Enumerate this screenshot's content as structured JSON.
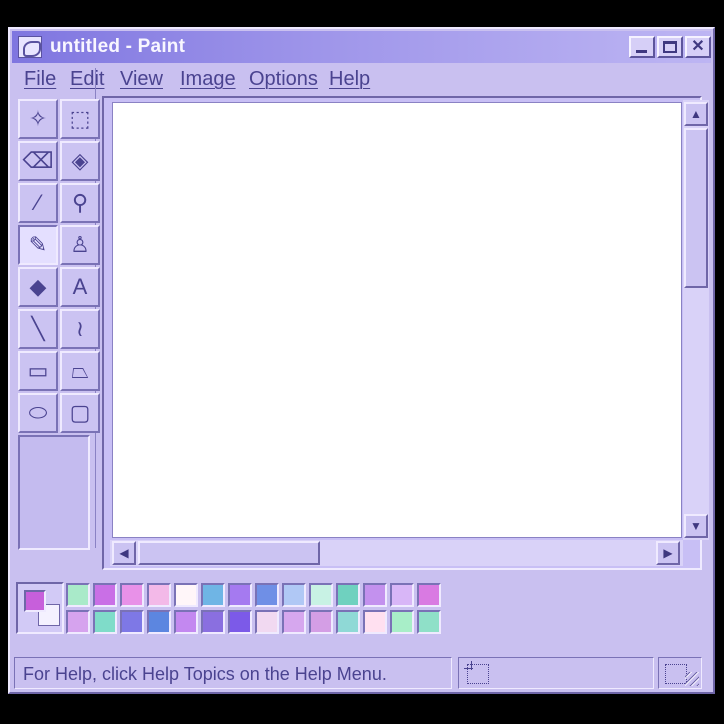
{
  "window": {
    "title": "untitled - Paint"
  },
  "menu": [
    {
      "label": "File"
    },
    {
      "label": "Edit"
    },
    {
      "label": "View"
    },
    {
      "label": "Image"
    },
    {
      "label": "Options"
    },
    {
      "label": "Help"
    }
  ],
  "tools": [
    {
      "name": "free-form-select",
      "glyph": "✧",
      "icon": "free-form-select-icon"
    },
    {
      "name": "select",
      "glyph": "⬚",
      "icon": "rectangle-select-icon"
    },
    {
      "name": "eraser",
      "glyph": "⌫",
      "icon": "eraser-icon"
    },
    {
      "name": "fill-with-color",
      "glyph": "◈",
      "icon": "paint-bucket-icon"
    },
    {
      "name": "pick-color",
      "glyph": "⁄",
      "icon": "color-picker-icon"
    },
    {
      "name": "magnifier",
      "glyph": "⚲",
      "icon": "magnifier-icon"
    },
    {
      "name": "pencil",
      "glyph": "✎",
      "icon": "pencil-icon",
      "selected": true
    },
    {
      "name": "brush",
      "glyph": "♙",
      "icon": "brush-icon"
    },
    {
      "name": "airbrush",
      "glyph": "◆",
      "icon": "airbrush-icon"
    },
    {
      "name": "text",
      "glyph": "A",
      "icon": "text-icon"
    },
    {
      "name": "line",
      "glyph": "╲",
      "icon": "line-icon"
    },
    {
      "name": "curve",
      "glyph": "≀",
      "icon": "curve-icon"
    },
    {
      "name": "rectangle",
      "glyph": "▭",
      "icon": "rectangle-icon"
    },
    {
      "name": "polygon",
      "glyph": "⏢",
      "icon": "polygon-icon"
    },
    {
      "name": "ellipse",
      "glyph": "⬭",
      "icon": "ellipse-icon"
    },
    {
      "name": "rounded-rectangle",
      "glyph": "▢",
      "icon": "rounded-rectangle-icon"
    }
  ],
  "colors": {
    "foreground": "#c75fdb",
    "background": "#f4f1ff"
  },
  "palette": {
    "row1": [
      "#a9eac9",
      "#c96fe6",
      "#e891e8",
      "#f3b9e8",
      "#fff6f9",
      "#6fb5e5",
      "#a57af0",
      "#6f8fe6",
      "#b0c8f5",
      "#c8f2e4",
      "#6fd1bf",
      "#c391ee",
      "#d8b6f7",
      "#d97ae2"
    ],
    "row2": [
      "#d6a3ee",
      "#7fdcc9",
      "#7e78e6",
      "#5c86e0",
      "#c388f0",
      "#8a6fe0",
      "#7c5ae8",
      "#f1d9f1",
      "#d6a7ee",
      "#d49ee5",
      "#8fd9d6",
      "#ffe0f0",
      "#a8eec8",
      "#8fe0c8"
    ]
  },
  "status": {
    "help_text": "For Help, click Help Topics on the Help Menu."
  },
  "icons": {
    "app": "paint-app-icon",
    "position": "cursor-position-icon",
    "size": "selection-size-icon"
  }
}
